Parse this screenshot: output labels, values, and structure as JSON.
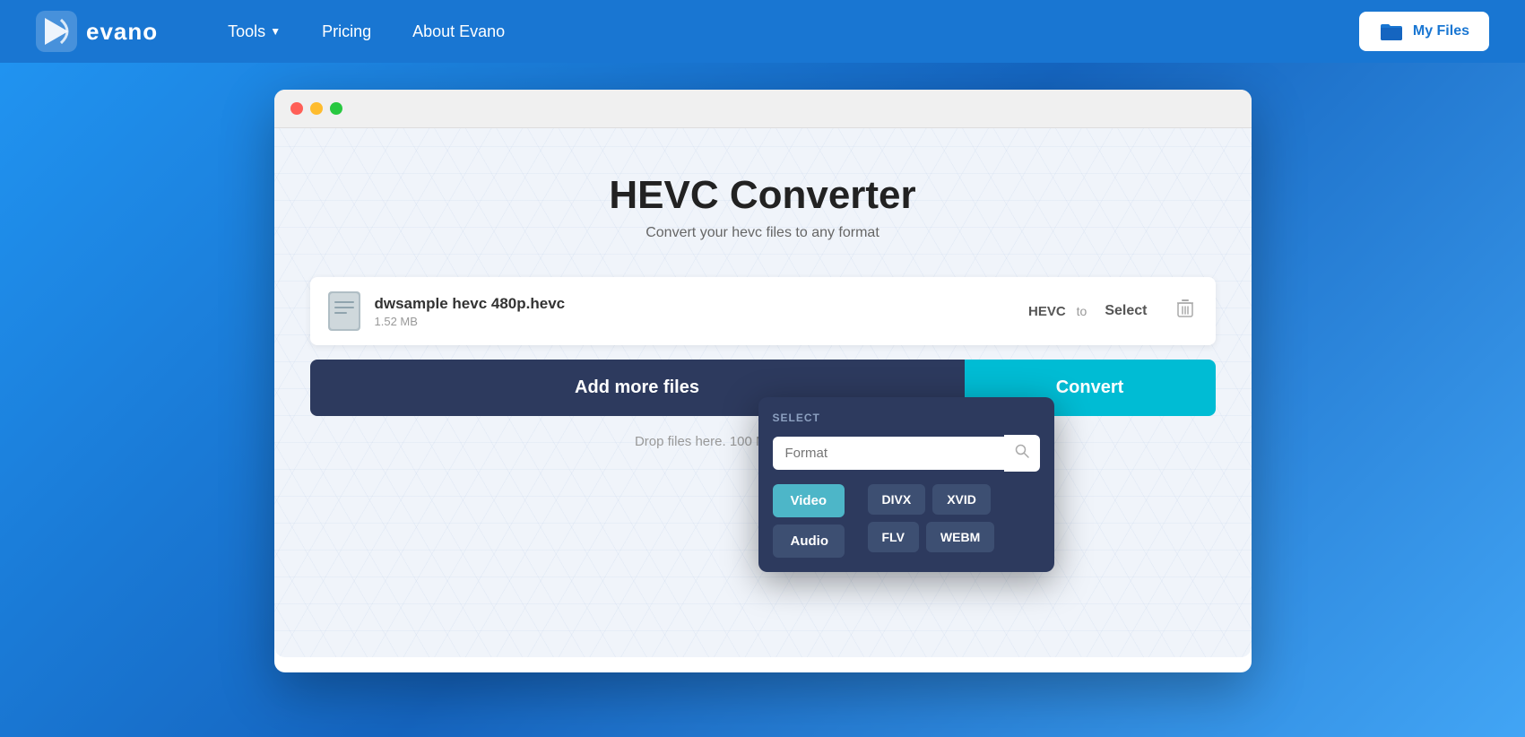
{
  "navbar": {
    "logo_text": "evano",
    "nav_items": [
      {
        "label": "Tools",
        "has_arrow": true
      },
      {
        "label": "Pricing",
        "has_arrow": false
      },
      {
        "label": "About Evano",
        "has_arrow": false
      }
    ],
    "my_files_label": "My Files"
  },
  "browser": {
    "title": "HEVC Converter",
    "subtitle": "Convert your hevc files to any format"
  },
  "file": {
    "name": "dwsample hevc 480p.hevc",
    "size": "1.52 MB",
    "format_from": "HEVC",
    "format_to_label": "to",
    "format_select_placeholder": "Select",
    "delete_icon": "🗑"
  },
  "actions": {
    "add_files_label": "Add more files",
    "convert_label": "Convert",
    "drop_hint": "Drop files here. 100 MB maximum file size."
  },
  "dropdown": {
    "select_label": "SELECT",
    "search_placeholder": "Format",
    "categories": [
      {
        "label": "Video",
        "active": true
      },
      {
        "label": "Audio",
        "active": false
      }
    ],
    "formats": [
      "DIVX",
      "XVID",
      "FLV",
      "WEBM"
    ]
  }
}
